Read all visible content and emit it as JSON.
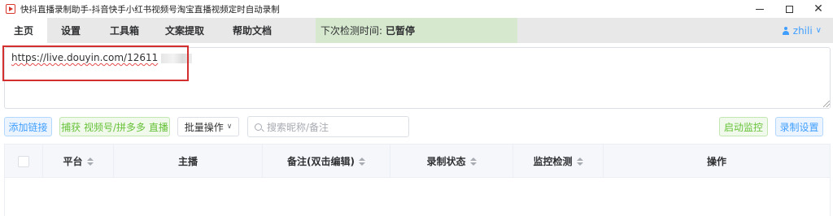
{
  "window": {
    "title": "快抖直播录制助手-抖音快手小红书视频号淘宝直播视频定时自动录制",
    "minimize": "–",
    "maximize": "□",
    "close": "✕"
  },
  "tabs": [
    {
      "label": "主页",
      "active": true
    },
    {
      "label": "设置"
    },
    {
      "label": "工具箱"
    },
    {
      "label": "文案提取"
    },
    {
      "label": "帮助文档"
    }
  ],
  "status": {
    "label": "下次检测时间:",
    "value": "已暂停"
  },
  "user": {
    "name": "zhili"
  },
  "url_input": {
    "value": "https://live.douyin.com/12611"
  },
  "toolbar": {
    "add_link": "添加链接",
    "capture": "捕获 视频号/拼多多 直播",
    "batch": "批量操作",
    "search_placeholder": "搜索昵称/备注",
    "start_monitor": "启动监控",
    "record_settings": "录制设置"
  },
  "table": {
    "columns": [
      "平台",
      "主播",
      "备注(双击编辑)",
      "录制状态",
      "监控检测",
      "操作"
    ]
  },
  "colors": {
    "accent": "#409eff",
    "success": "#67c23a",
    "status_bg": "#d6e9cf",
    "highlight": "#d32f2f"
  }
}
